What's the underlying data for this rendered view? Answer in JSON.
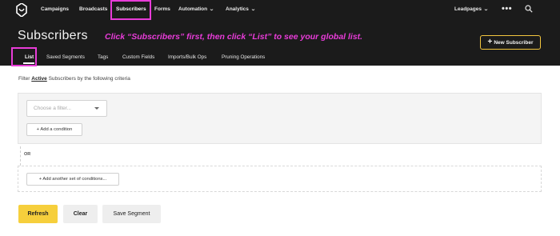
{
  "nav": {
    "items": [
      {
        "label": "Campaigns"
      },
      {
        "label": "Broadcasts"
      },
      {
        "label": "Subscribers"
      },
      {
        "label": "Forms"
      },
      {
        "label": "Automation"
      },
      {
        "label": "Analytics"
      }
    ],
    "account": "Leadpages",
    "more": "•••"
  },
  "page": {
    "title": "Subscribers",
    "annotation": "Click “Subscribers” first, then click “List” to see your global list.",
    "new_subscriber": "New Subscriber"
  },
  "tabs": [
    "List",
    "Saved Segments",
    "Tags",
    "Custom Fields",
    "Imports/Bulk Ops",
    "Pruning Operations"
  ],
  "filter": {
    "prefix": "Filter",
    "status": "Active",
    "suffix": "Subscribers by the following criteria",
    "select_placeholder": "Choose a filter...",
    "add_condition": "+ Add a condition",
    "or": "OR",
    "add_set": "+ Add another set of conditions..."
  },
  "actions": {
    "refresh": "Refresh",
    "clear": "Clear",
    "save": "Save Segment"
  },
  "colors": {
    "accent": "#f6cf3c",
    "highlight": "#e83cd8",
    "header_bg": "#1b1b1b"
  }
}
